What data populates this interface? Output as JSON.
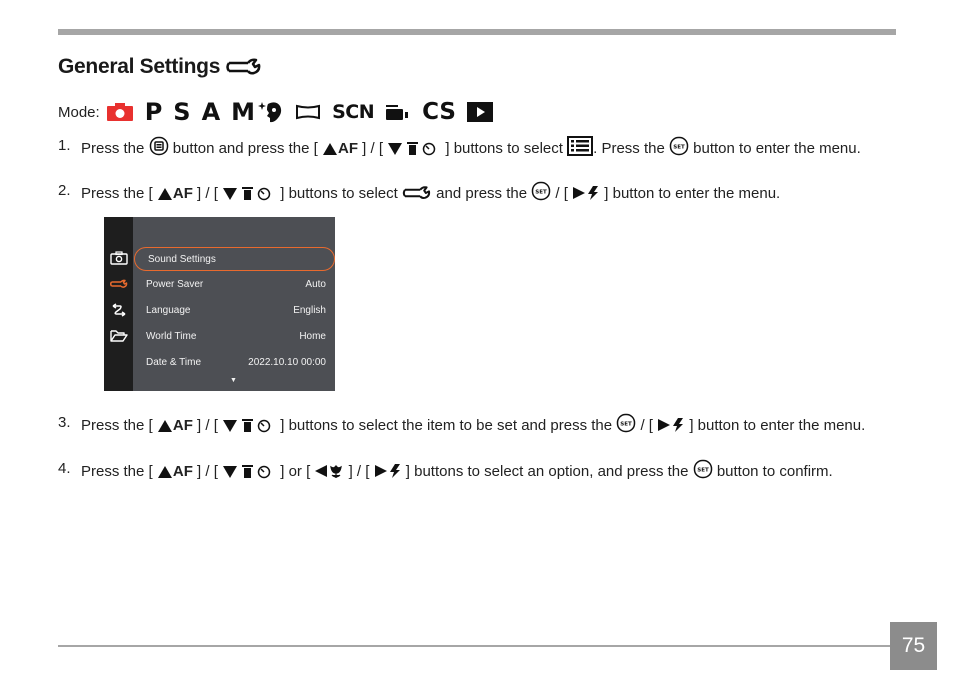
{
  "header": {
    "title": "General Settings",
    "title_icon": "wrench-icon"
  },
  "mode": {
    "label": "Mode:",
    "modes": [
      {
        "name": "auto-camera-mode",
        "icon": "camera-icon",
        "color": "#e8312f"
      },
      {
        "name": "program-mode",
        "text": "P"
      },
      {
        "name": "shutter-priority-mode",
        "text": "S"
      },
      {
        "name": "aperture-priority-mode",
        "text": "A"
      },
      {
        "name": "manual-mode",
        "text": "M"
      },
      {
        "name": "beauty-mode",
        "icon": "face-sparkle-icon"
      },
      {
        "name": "panorama-mode",
        "icon": "panorama-icon"
      },
      {
        "name": "scene-mode",
        "text": "SCN"
      },
      {
        "name": "movie-mode",
        "icon": "video-camera-icon"
      },
      {
        "name": "custom-settings-mode",
        "text": "CS"
      },
      {
        "name": "playback-mode",
        "icon": "play-icon"
      }
    ]
  },
  "steps": [
    {
      "num": "1.",
      "parts": {
        "a": "Press the",
        "b": "button and press the [",
        "c": "AF",
        "d": "] / [",
        "e": "] buttons to select",
        "f": ". Press the",
        "g": "button to enter the menu."
      }
    },
    {
      "num": "2.",
      "parts": {
        "a": "Press the [",
        "c": "AF",
        "d": "] / [",
        "e": "] buttons to select",
        "f": "and press the",
        "g": "/ [",
        "h": "] button to enter the menu."
      }
    },
    {
      "num": "3.",
      "parts": {
        "a": "Press the [",
        "c": "AF",
        "d": "] / [",
        "e": "] buttons to select the item to be set and press the",
        "g": "/ [",
        "h": "] button to enter the menu."
      }
    },
    {
      "num": "4.",
      "parts": {
        "a": "Press the [",
        "c": "AF",
        "d": "] / [",
        "e": "] or [",
        "f": "] / [",
        "h": "] buttons to select an option, and press the",
        "i": "button to confirm."
      }
    }
  ],
  "camera_screen": {
    "side_icons": [
      {
        "icon": "camera-icon",
        "active": false
      },
      {
        "icon": "wrench-icon",
        "active": true
      },
      {
        "icon": "transfer-icon",
        "active": false
      },
      {
        "icon": "folder-icon",
        "active": false
      }
    ],
    "menu": [
      {
        "label": "Sound Settings",
        "value": "",
        "selected": true
      },
      {
        "label": "Power Saver",
        "value": "Auto"
      },
      {
        "label": "Language",
        "value": "English"
      },
      {
        "label": "World Time",
        "value": "Home"
      },
      {
        "label": "Date & Time",
        "value": "2022.10.10 00:00"
      }
    ],
    "more_indicator": "▼",
    "accent_color": "#e86a2e"
  },
  "footer": {
    "page_number": "75"
  }
}
